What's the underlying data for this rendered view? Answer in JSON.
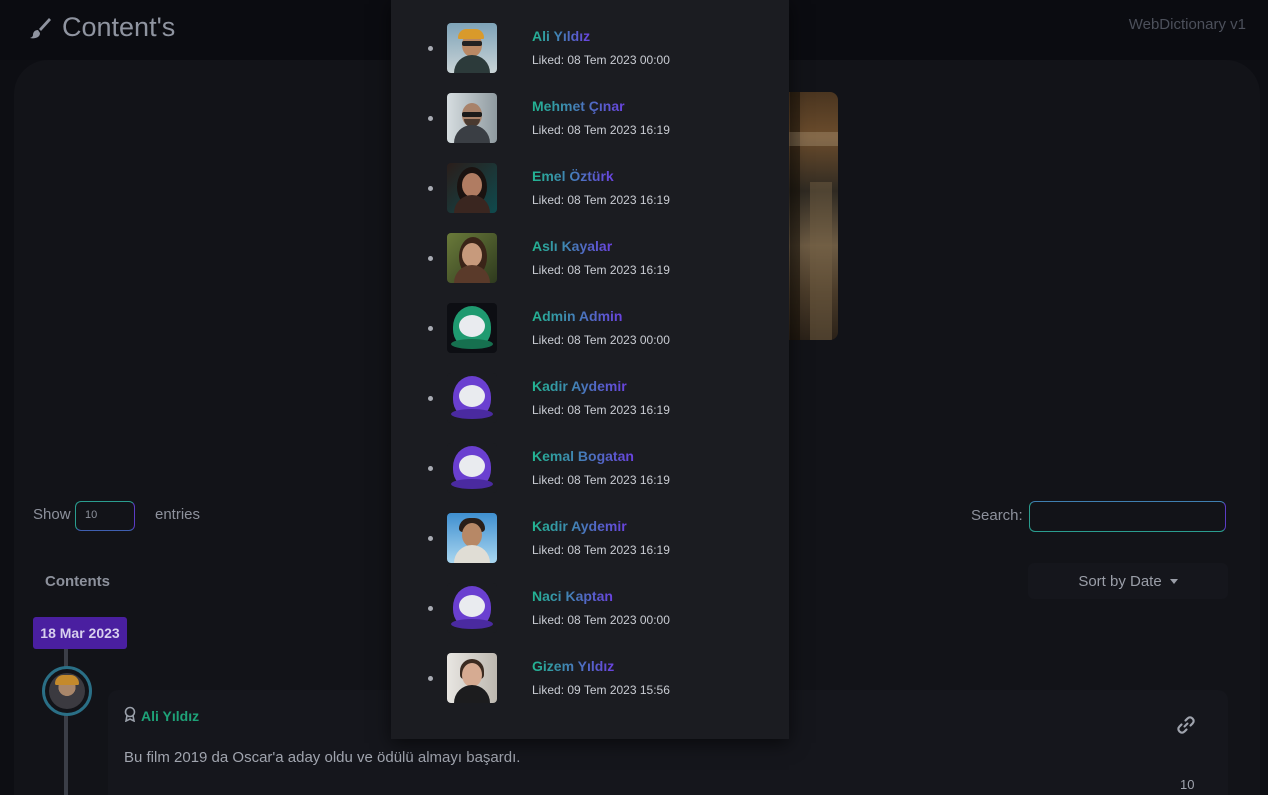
{
  "header": {
    "title": "Content's",
    "version": "WebDictionary v1"
  },
  "table_controls": {
    "show_label": "Show",
    "page_size": "10",
    "entries_label": "entries",
    "search_label": "Search:",
    "search_value": ""
  },
  "contents": {
    "heading": "Contents",
    "sort_label": "Sort by Date",
    "date_badge": "18 Mar 2023",
    "comment": {
      "author": "Ali Yıldız",
      "text": "Bu film 2019 da Oscar'a aday oldu ve ödülü almayı başardı.",
      "like_count": "10"
    }
  },
  "likes_popup": {
    "items": [
      {
        "name": "Ali Yıldız",
        "liked": "Liked: 08 Tem 2023 00:00",
        "avatar": "photo-cap"
      },
      {
        "name": "Mehmet Çınar",
        "liked": "Liked: 08 Tem 2023 16:19",
        "avatar": "photo-sunglasses"
      },
      {
        "name": "Emel Öztürk",
        "liked": "Liked: 08 Tem 2023 16:19",
        "avatar": "photo-woman-dark"
      },
      {
        "name": "Aslı Kayalar",
        "liked": "Liked: 08 Tem 2023 16:19",
        "avatar": "photo-woman-leaves"
      },
      {
        "name": "Admin Admin",
        "liked": "Liked: 08 Tem 2023 00:00",
        "avatar": "astronaut-green"
      },
      {
        "name": "Kadir Aydemir",
        "liked": "Liked: 08 Tem 2023 16:19",
        "avatar": "astronaut-purple"
      },
      {
        "name": "Kemal Bogatan",
        "liked": "Liked: 08 Tem 2023 16:19",
        "avatar": "astronaut-purple"
      },
      {
        "name": "Kadir Aydemir",
        "liked": "Liked: 08 Tem 2023 16:19",
        "avatar": "photo-man-sky"
      },
      {
        "name": "Naci Kaptan",
        "liked": "Liked: 08 Tem 2023 00:00",
        "avatar": "astronaut-purple"
      },
      {
        "name": "Gizem Yıldız",
        "liked": "Liked: 09 Tem 2023 15:56",
        "avatar": "photo-woman-light"
      }
    ]
  },
  "colors": {
    "accent_teal": "#22b591",
    "accent_purple": "#6a42e0",
    "date_badge": "#4a1fa0",
    "background": "#0d0e13"
  }
}
